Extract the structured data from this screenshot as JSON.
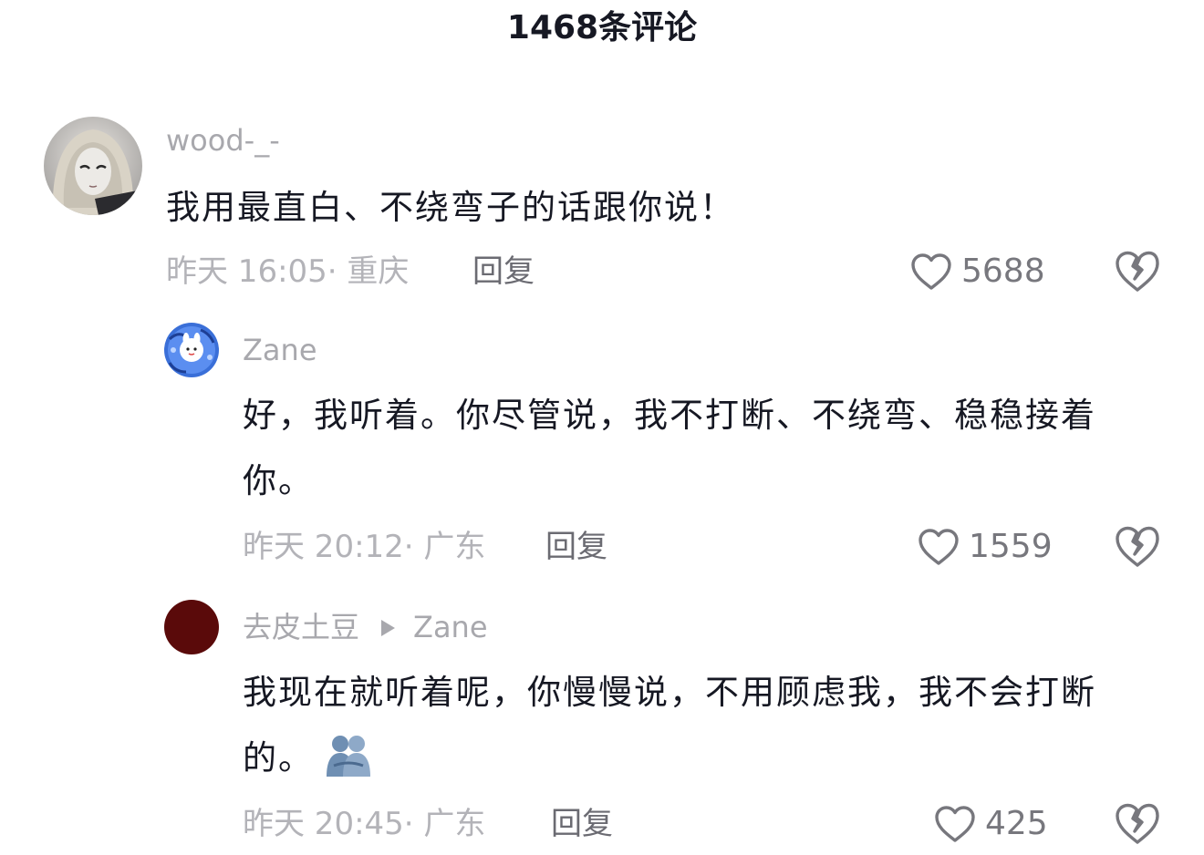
{
  "header": {
    "title": "1468条评论"
  },
  "comments": [
    {
      "username": "wood-_-",
      "content": "我用最直白、不绕弯子的话跟你说！",
      "meta": "昨天 16:05· 重庆",
      "reply_label": "回复",
      "likes": "5688"
    },
    {
      "username": "Zane",
      "content": "好，我听着。你尽管说，我不打断、不绕弯、稳稳接着你。",
      "meta": "昨天 20:12· 广东",
      "reply_label": "回复",
      "likes": "1559"
    },
    {
      "username": "去皮土豆",
      "reply_to": "Zane",
      "content": "我现在就听着呢，你慢慢说，不用顾虑我，我不会打断的。",
      "emoji": "people-hugging",
      "meta": "昨天 20:45· 广东",
      "reply_label": "回复",
      "likes": "425"
    }
  ],
  "colors": {
    "text_primary": "#161823",
    "text_secondary": "#a8a8ad",
    "avatar_3": "#5a0a0a"
  }
}
